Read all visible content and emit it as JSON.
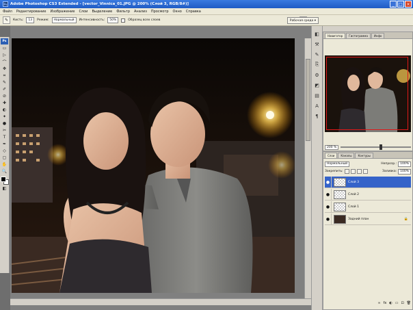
{
  "window": {
    "title": "Adobe Photoshop CS3 Extended - [vector_Vinnica_01.JPG @ 200% (Слой 3, RGB/8#)]",
    "min": "_",
    "max": "□",
    "close": "×"
  },
  "menu": [
    "Файл",
    "Редактирование",
    "Изображение",
    "Слои",
    "Выделение",
    "Фильтр",
    "Анализ",
    "Просмотр",
    "Окно",
    "Справка"
  ],
  "options": {
    "brush_label": "Кисть:",
    "brush_size": "13",
    "mode_label": "Режим:",
    "mode_value": "Нормальный",
    "opacity_label": "Интенсивность:",
    "opacity_value": "50%",
    "sample_label": "Образец всех слоев",
    "workspace": "Рабочая среда ▾"
  },
  "tools": {
    "ps_badge": "Ps",
    "items": [
      "▭",
      "▷",
      "⌒",
      "✥",
      "⌗",
      "✎",
      "✐",
      "⊘",
      "✚",
      "◐",
      "✦",
      "●",
      "✂",
      "T",
      "✒",
      "◇",
      "▢",
      "✋",
      "🔍",
      "◧"
    ]
  },
  "colors": {
    "selection_blue": "#3563c9",
    "title_blue": "#1f5bc4",
    "nav_frame_red": "#e01818"
  },
  "dock_icons": [
    "◧",
    "⚒",
    "✎",
    "⎘",
    "⚙",
    "◩",
    "▤",
    "A",
    "¶"
  ],
  "navigator": {
    "tabs": [
      "Навигатор",
      "Гистограмма",
      "Инфо"
    ],
    "zoom": "200 %"
  },
  "layers": {
    "tabs": [
      "Слои",
      "Каналы",
      "Контуры"
    ],
    "blend_mode": "Нормальный",
    "opacity_label": "Непрозр.:",
    "opacity_value": "100%",
    "lock_label": "Закрепить:",
    "fill_label": "Заливка:",
    "fill_value": "100%",
    "items": [
      {
        "name": "Слой 3",
        "active": true
      },
      {
        "name": "Слой 2",
        "active": false
      },
      {
        "name": "Слой 1",
        "active": false
      },
      {
        "name": "Задний план",
        "active": false
      }
    ],
    "bottom_icons": [
      "∞",
      "fx",
      "◐",
      "▭",
      "⊡",
      "🗑"
    ]
  }
}
